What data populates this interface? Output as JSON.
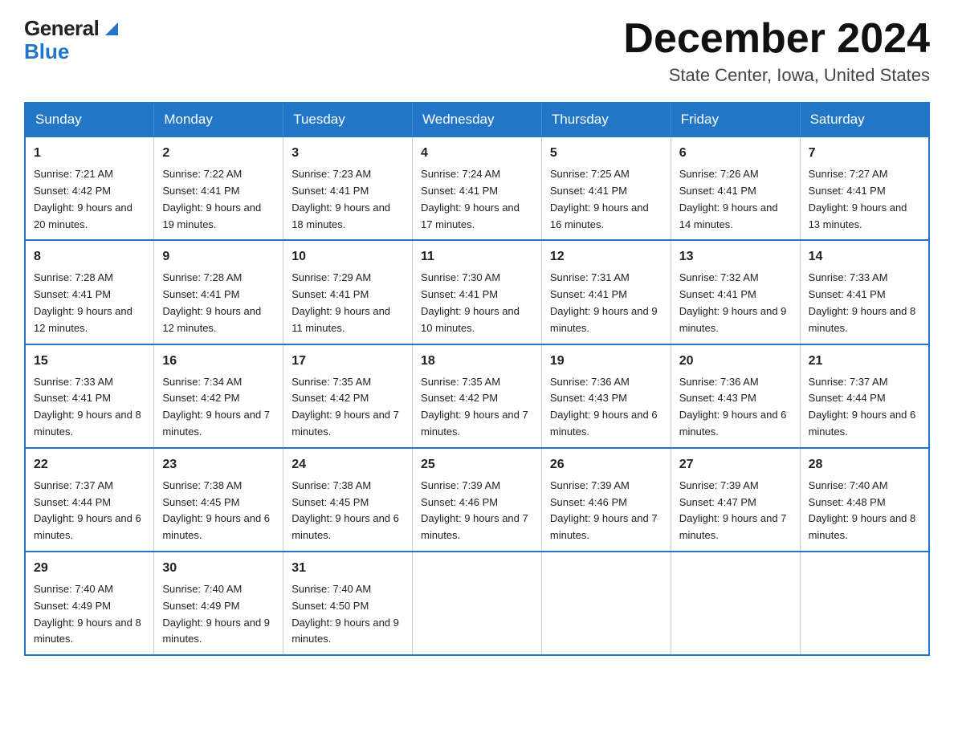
{
  "header": {
    "logo_general": "General",
    "logo_blue": "Blue",
    "month_title": "December 2024",
    "location": "State Center, Iowa, United States"
  },
  "days_of_week": [
    "Sunday",
    "Monday",
    "Tuesday",
    "Wednesday",
    "Thursday",
    "Friday",
    "Saturday"
  ],
  "weeks": [
    [
      {
        "day": "1",
        "sunrise": "7:21 AM",
        "sunset": "4:42 PM",
        "daylight": "9 hours and 20 minutes."
      },
      {
        "day": "2",
        "sunrise": "7:22 AM",
        "sunset": "4:41 PM",
        "daylight": "9 hours and 19 minutes."
      },
      {
        "day": "3",
        "sunrise": "7:23 AM",
        "sunset": "4:41 PM",
        "daylight": "9 hours and 18 minutes."
      },
      {
        "day": "4",
        "sunrise": "7:24 AM",
        "sunset": "4:41 PM",
        "daylight": "9 hours and 17 minutes."
      },
      {
        "day": "5",
        "sunrise": "7:25 AM",
        "sunset": "4:41 PM",
        "daylight": "9 hours and 16 minutes."
      },
      {
        "day": "6",
        "sunrise": "7:26 AM",
        "sunset": "4:41 PM",
        "daylight": "9 hours and 14 minutes."
      },
      {
        "day": "7",
        "sunrise": "7:27 AM",
        "sunset": "4:41 PM",
        "daylight": "9 hours and 13 minutes."
      }
    ],
    [
      {
        "day": "8",
        "sunrise": "7:28 AM",
        "sunset": "4:41 PM",
        "daylight": "9 hours and 12 minutes."
      },
      {
        "day": "9",
        "sunrise": "7:28 AM",
        "sunset": "4:41 PM",
        "daylight": "9 hours and 12 minutes."
      },
      {
        "day": "10",
        "sunrise": "7:29 AM",
        "sunset": "4:41 PM",
        "daylight": "9 hours and 11 minutes."
      },
      {
        "day": "11",
        "sunrise": "7:30 AM",
        "sunset": "4:41 PM",
        "daylight": "9 hours and 10 minutes."
      },
      {
        "day": "12",
        "sunrise": "7:31 AM",
        "sunset": "4:41 PM",
        "daylight": "9 hours and 9 minutes."
      },
      {
        "day": "13",
        "sunrise": "7:32 AM",
        "sunset": "4:41 PM",
        "daylight": "9 hours and 9 minutes."
      },
      {
        "day": "14",
        "sunrise": "7:33 AM",
        "sunset": "4:41 PM",
        "daylight": "9 hours and 8 minutes."
      }
    ],
    [
      {
        "day": "15",
        "sunrise": "7:33 AM",
        "sunset": "4:41 PM",
        "daylight": "9 hours and 8 minutes."
      },
      {
        "day": "16",
        "sunrise": "7:34 AM",
        "sunset": "4:42 PM",
        "daylight": "9 hours and 7 minutes."
      },
      {
        "day": "17",
        "sunrise": "7:35 AM",
        "sunset": "4:42 PM",
        "daylight": "9 hours and 7 minutes."
      },
      {
        "day": "18",
        "sunrise": "7:35 AM",
        "sunset": "4:42 PM",
        "daylight": "9 hours and 7 minutes."
      },
      {
        "day": "19",
        "sunrise": "7:36 AM",
        "sunset": "4:43 PM",
        "daylight": "9 hours and 6 minutes."
      },
      {
        "day": "20",
        "sunrise": "7:36 AM",
        "sunset": "4:43 PM",
        "daylight": "9 hours and 6 minutes."
      },
      {
        "day": "21",
        "sunrise": "7:37 AM",
        "sunset": "4:44 PM",
        "daylight": "9 hours and 6 minutes."
      }
    ],
    [
      {
        "day": "22",
        "sunrise": "7:37 AM",
        "sunset": "4:44 PM",
        "daylight": "9 hours and 6 minutes."
      },
      {
        "day": "23",
        "sunrise": "7:38 AM",
        "sunset": "4:45 PM",
        "daylight": "9 hours and 6 minutes."
      },
      {
        "day": "24",
        "sunrise": "7:38 AM",
        "sunset": "4:45 PM",
        "daylight": "9 hours and 6 minutes."
      },
      {
        "day": "25",
        "sunrise": "7:39 AM",
        "sunset": "4:46 PM",
        "daylight": "9 hours and 7 minutes."
      },
      {
        "day": "26",
        "sunrise": "7:39 AM",
        "sunset": "4:46 PM",
        "daylight": "9 hours and 7 minutes."
      },
      {
        "day": "27",
        "sunrise": "7:39 AM",
        "sunset": "4:47 PM",
        "daylight": "9 hours and 7 minutes."
      },
      {
        "day": "28",
        "sunrise": "7:40 AM",
        "sunset": "4:48 PM",
        "daylight": "9 hours and 8 minutes."
      }
    ],
    [
      {
        "day": "29",
        "sunrise": "7:40 AM",
        "sunset": "4:49 PM",
        "daylight": "9 hours and 8 minutes."
      },
      {
        "day": "30",
        "sunrise": "7:40 AM",
        "sunset": "4:49 PM",
        "daylight": "9 hours and 9 minutes."
      },
      {
        "day": "31",
        "sunrise": "7:40 AM",
        "sunset": "4:50 PM",
        "daylight": "9 hours and 9 minutes."
      },
      null,
      null,
      null,
      null
    ]
  ],
  "labels": {
    "sunrise": "Sunrise: ",
    "sunset": "Sunset: ",
    "daylight": "Daylight: "
  },
  "colors": {
    "header_bg": "#2176c7",
    "header_text": "#ffffff",
    "border": "#2176c7"
  }
}
